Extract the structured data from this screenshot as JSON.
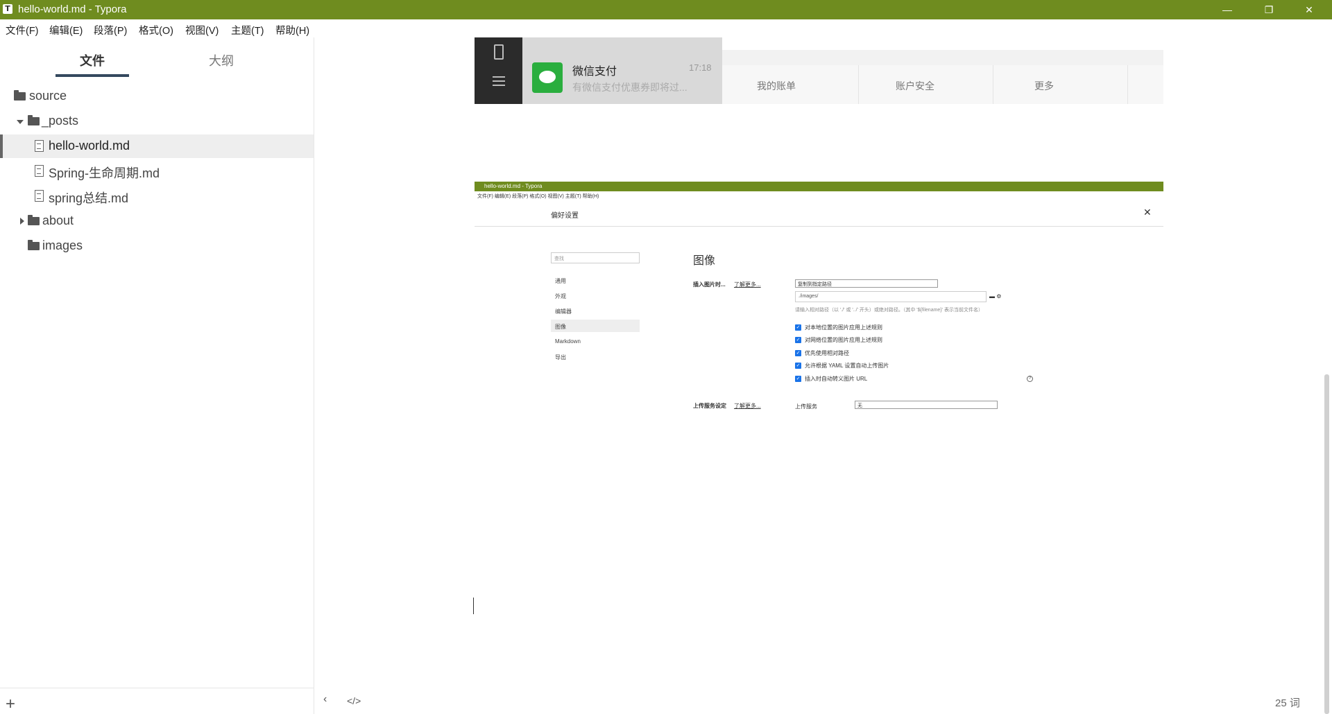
{
  "window": {
    "title": "hello-world.md - Typora",
    "app_icon": "T",
    "minimize": "—",
    "maximize": "❐",
    "close": "✕"
  },
  "menu": [
    "文件(F)",
    "编辑(E)",
    "段落(P)",
    "格式(O)",
    "视图(V)",
    "主题(T)",
    "帮助(H)"
  ],
  "sidebar": {
    "tabs": [
      "文件",
      "大纲"
    ],
    "tree": [
      {
        "label": "source",
        "type": "folder"
      },
      {
        "label": "_posts",
        "type": "folder",
        "expanded": true
      },
      {
        "label": "hello-world.md",
        "type": "file",
        "selected": true
      },
      {
        "label": "Spring-生命周期.md",
        "type": "file"
      },
      {
        "label": "spring总结.md",
        "type": "file"
      },
      {
        "label": "about",
        "type": "folder",
        "collapsed": true
      },
      {
        "label": "images",
        "type": "folder"
      }
    ],
    "add_button": "+"
  },
  "image1": {
    "chat_name": "微信支付",
    "chat_time": "17:18",
    "chat_preview": "有微信支付优惠券即将过...",
    "footer": [
      "我的账单",
      "账户安全",
      "更多"
    ]
  },
  "image2": {
    "title": "hello-world.md - Typora",
    "menu": "文件(F)  编辑(E)  段落(P)  格式(O)  视图(V)  主题(T)  帮助(H)",
    "dialog_title": "偏好设置",
    "close": "✕",
    "search_placeholder": "查找",
    "nav": [
      "通用",
      "外观",
      "编辑器",
      "图像",
      "Markdown",
      "导出"
    ],
    "heading": "图像",
    "insert_label": "插入图片时...",
    "learn_more": "了解更多...",
    "insert_select": "复制到指定路径",
    "path_value": "./images/",
    "path_hint": "请输入相对路径（以 './' 或 '../' 开头）或绝对路径。（其中 '${filename}' 表示当前文件名）",
    "checkboxes": [
      "对本地位置的图片应用上述规则",
      "对网络位置的图片应用上述规则",
      "优先使用相对路径",
      "允许根据 YAML 设置自动上传图片",
      "插入时自动转义图片 URL"
    ],
    "upload_label": "上传服务设定",
    "upload_service_label": "上传服务",
    "upload_select": "无"
  },
  "status": {
    "back": "‹",
    "source_toggle": "</>",
    "word_count": "25 词"
  }
}
